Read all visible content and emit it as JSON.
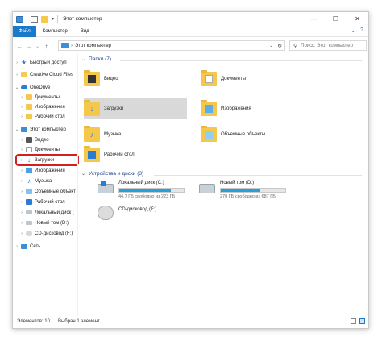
{
  "title": "Этот компьютер",
  "window_controls": {
    "minimize": "—",
    "maximize": "☐",
    "close": "✕"
  },
  "ribbon": {
    "tabs": [
      "Файл",
      "Компьютер",
      "Вид"
    ],
    "expand_icon": "chevron-down-icon",
    "help_icon": "?"
  },
  "address": {
    "back": "←",
    "forward": "→",
    "history": "⌄",
    "up": "↑",
    "path": "Этот компьютер",
    "chevron": "⌄",
    "refresh": "↻"
  },
  "search": {
    "icon": "⚲",
    "placeholder": "Поиск: Этот компьютер"
  },
  "nav": {
    "items": [
      {
        "label": "Быстрый доступ",
        "arrow": "›",
        "icon": "star"
      },
      {
        "label": "Creative Cloud Files",
        "arrow": "›",
        "icon": "cc"
      },
      {
        "label": "OneDrive",
        "arrow": "⌄",
        "icon": "cloud"
      },
      {
        "label": "Документы",
        "arrow": "›",
        "icon": "folder"
      },
      {
        "label": "Изображения",
        "arrow": "›",
        "icon": "folder"
      },
      {
        "label": "Рабочий стол",
        "arrow": "›",
        "icon": "folder"
      },
      {
        "label": "Этот компьютер",
        "arrow": "⌄",
        "icon": "pc"
      },
      {
        "label": "Видео",
        "arrow": "›",
        "icon": "video"
      },
      {
        "label": "Документы",
        "arrow": "›",
        "icon": "doc"
      },
      {
        "label": "Загрузки",
        "arrow": "›",
        "icon": "download"
      },
      {
        "label": "Изображения",
        "arrow": "›",
        "icon": "img"
      },
      {
        "label": "Музыка",
        "arrow": "›",
        "icon": "music"
      },
      {
        "label": "Объемные объект",
        "arrow": "›",
        "icon": "3d"
      },
      {
        "label": "Рабочий стол",
        "arrow": "›",
        "icon": "desk"
      },
      {
        "label": "Локальный диск (",
        "arrow": "›",
        "icon": "drive"
      },
      {
        "label": "Новый том (D:)",
        "arrow": "›",
        "icon": "drive"
      },
      {
        "label": "CD-дисковод (F:)",
        "arrow": "›",
        "icon": "cd"
      },
      {
        "label": "Сеть",
        "arrow": "›",
        "icon": "net"
      }
    ]
  },
  "folders": {
    "header": "Папки (7)",
    "items": [
      {
        "label": "Видео",
        "overlay": "video"
      },
      {
        "label": "Документы",
        "overlay": "doc"
      },
      {
        "label": "Загрузки",
        "overlay": "download"
      },
      {
        "label": "Изображения",
        "overlay": "img"
      },
      {
        "label": "Музыка",
        "overlay": "music"
      },
      {
        "label": "Объемные объекты",
        "overlay": "3d"
      },
      {
        "label": "Рабочий стол",
        "overlay": "desk"
      }
    ]
  },
  "drives": {
    "header": "Устройства и диски (3)",
    "items": [
      {
        "name": "Локальный диск (C:)",
        "free": "44,7 ГБ свободно из 223 ГБ",
        "used_fraction": 0.8
      },
      {
        "name": "Новый том (D:)",
        "free": "270 ГБ свободно из 687 ГБ",
        "used_fraction": 0.61
      },
      {
        "name": "CD-дисковод (F:)",
        "free": "",
        "used_fraction": null
      }
    ]
  },
  "status": {
    "count": "Элементов: 10",
    "selected": "Выбран 1 элемент"
  },
  "colors": {
    "accent": "#1979ca",
    "highlight": "#d21f1f",
    "drive_fill": "#26a0da"
  }
}
